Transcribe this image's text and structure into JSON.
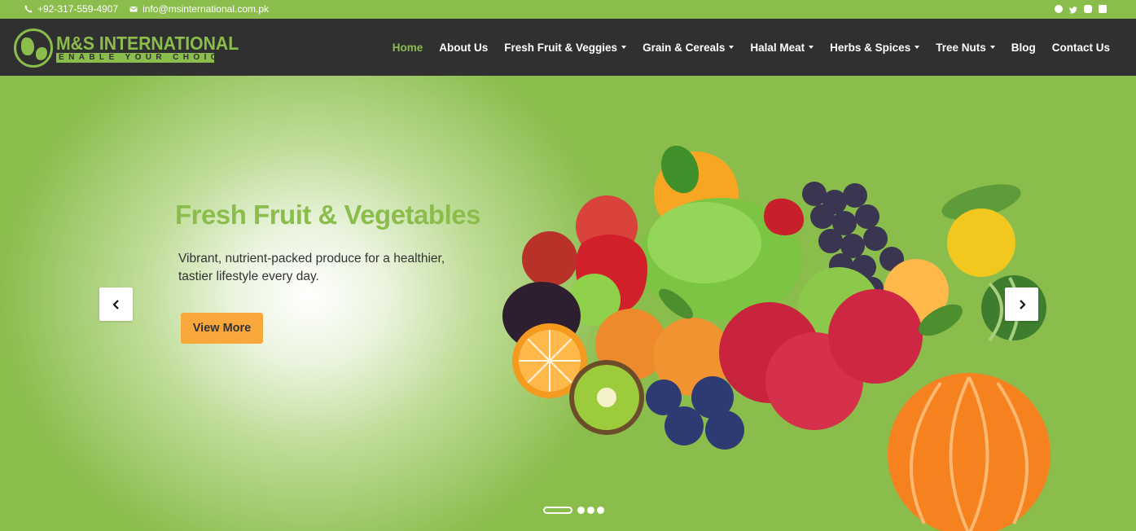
{
  "topbar": {
    "phone": "+92-317-559-4907",
    "email": "info@msinternational.com.pk",
    "social_icons": [
      "facebook-icon",
      "twitter-icon",
      "instagram-icon",
      "youtube-icon"
    ]
  },
  "brand": {
    "name": "M&S INTERNATIONAL",
    "tagline": "ENABLE YOUR CHOICES",
    "accent_color": "#8bbd4d",
    "header_bg": "#303030"
  },
  "nav": {
    "items": [
      {
        "label": "Home",
        "active": true,
        "dropdown": false
      },
      {
        "label": "About Us",
        "active": false,
        "dropdown": false
      },
      {
        "label": "Fresh Fruit & Veggies",
        "active": false,
        "dropdown": true
      },
      {
        "label": "Grain & Cereals",
        "active": false,
        "dropdown": true
      },
      {
        "label": "Halal Meat",
        "active": false,
        "dropdown": true
      },
      {
        "label": "Herbs & Spices",
        "active": false,
        "dropdown": true
      },
      {
        "label": "Tree Nuts",
        "active": false,
        "dropdown": true
      },
      {
        "label": "Blog",
        "active": false,
        "dropdown": false
      },
      {
        "label": "Contact Us",
        "active": false,
        "dropdown": false
      }
    ]
  },
  "hero": {
    "title": "Fresh Fruit & Vegetables",
    "description": "Vibrant, nutrient-packed produce for a healthier, tastier lifestyle every day.",
    "button_label": "View More",
    "button_color": "#f8a73a",
    "slide_count": 4,
    "active_slide": 1
  }
}
